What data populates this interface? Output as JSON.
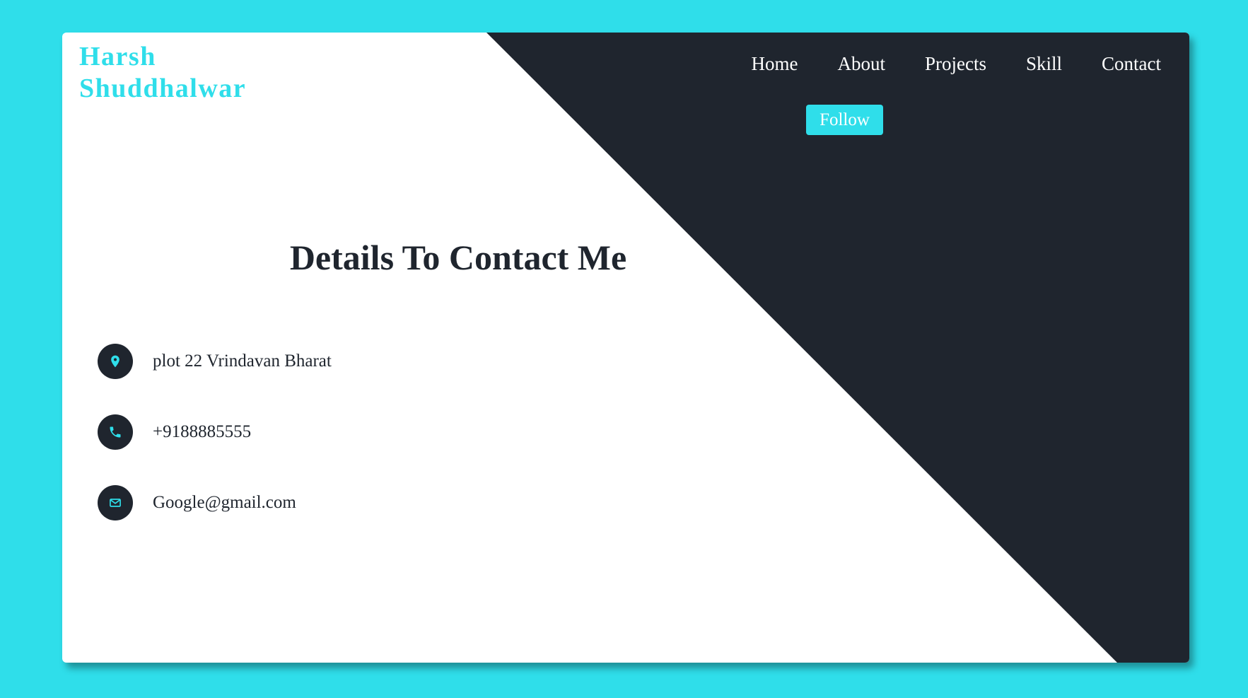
{
  "brand": {
    "name": "Harsh Shuddhalwar"
  },
  "nav": {
    "items": [
      "Home",
      "About",
      "Projects",
      "Skill",
      "Contact"
    ],
    "follow_label": "Follow"
  },
  "contact": {
    "title": "Details To Contact Me",
    "items": [
      {
        "icon": "location-pin-icon",
        "text": "plot 22 Vrindavan Bharat"
      },
      {
        "icon": "phone-icon",
        "text": "+9188885555"
      },
      {
        "icon": "envelope-icon",
        "text": "Google@gmail.com"
      }
    ]
  },
  "colors": {
    "background": "#2fdeea",
    "accent": "#2fdeea",
    "dark": "#1f252e",
    "card": "#ffffff"
  }
}
